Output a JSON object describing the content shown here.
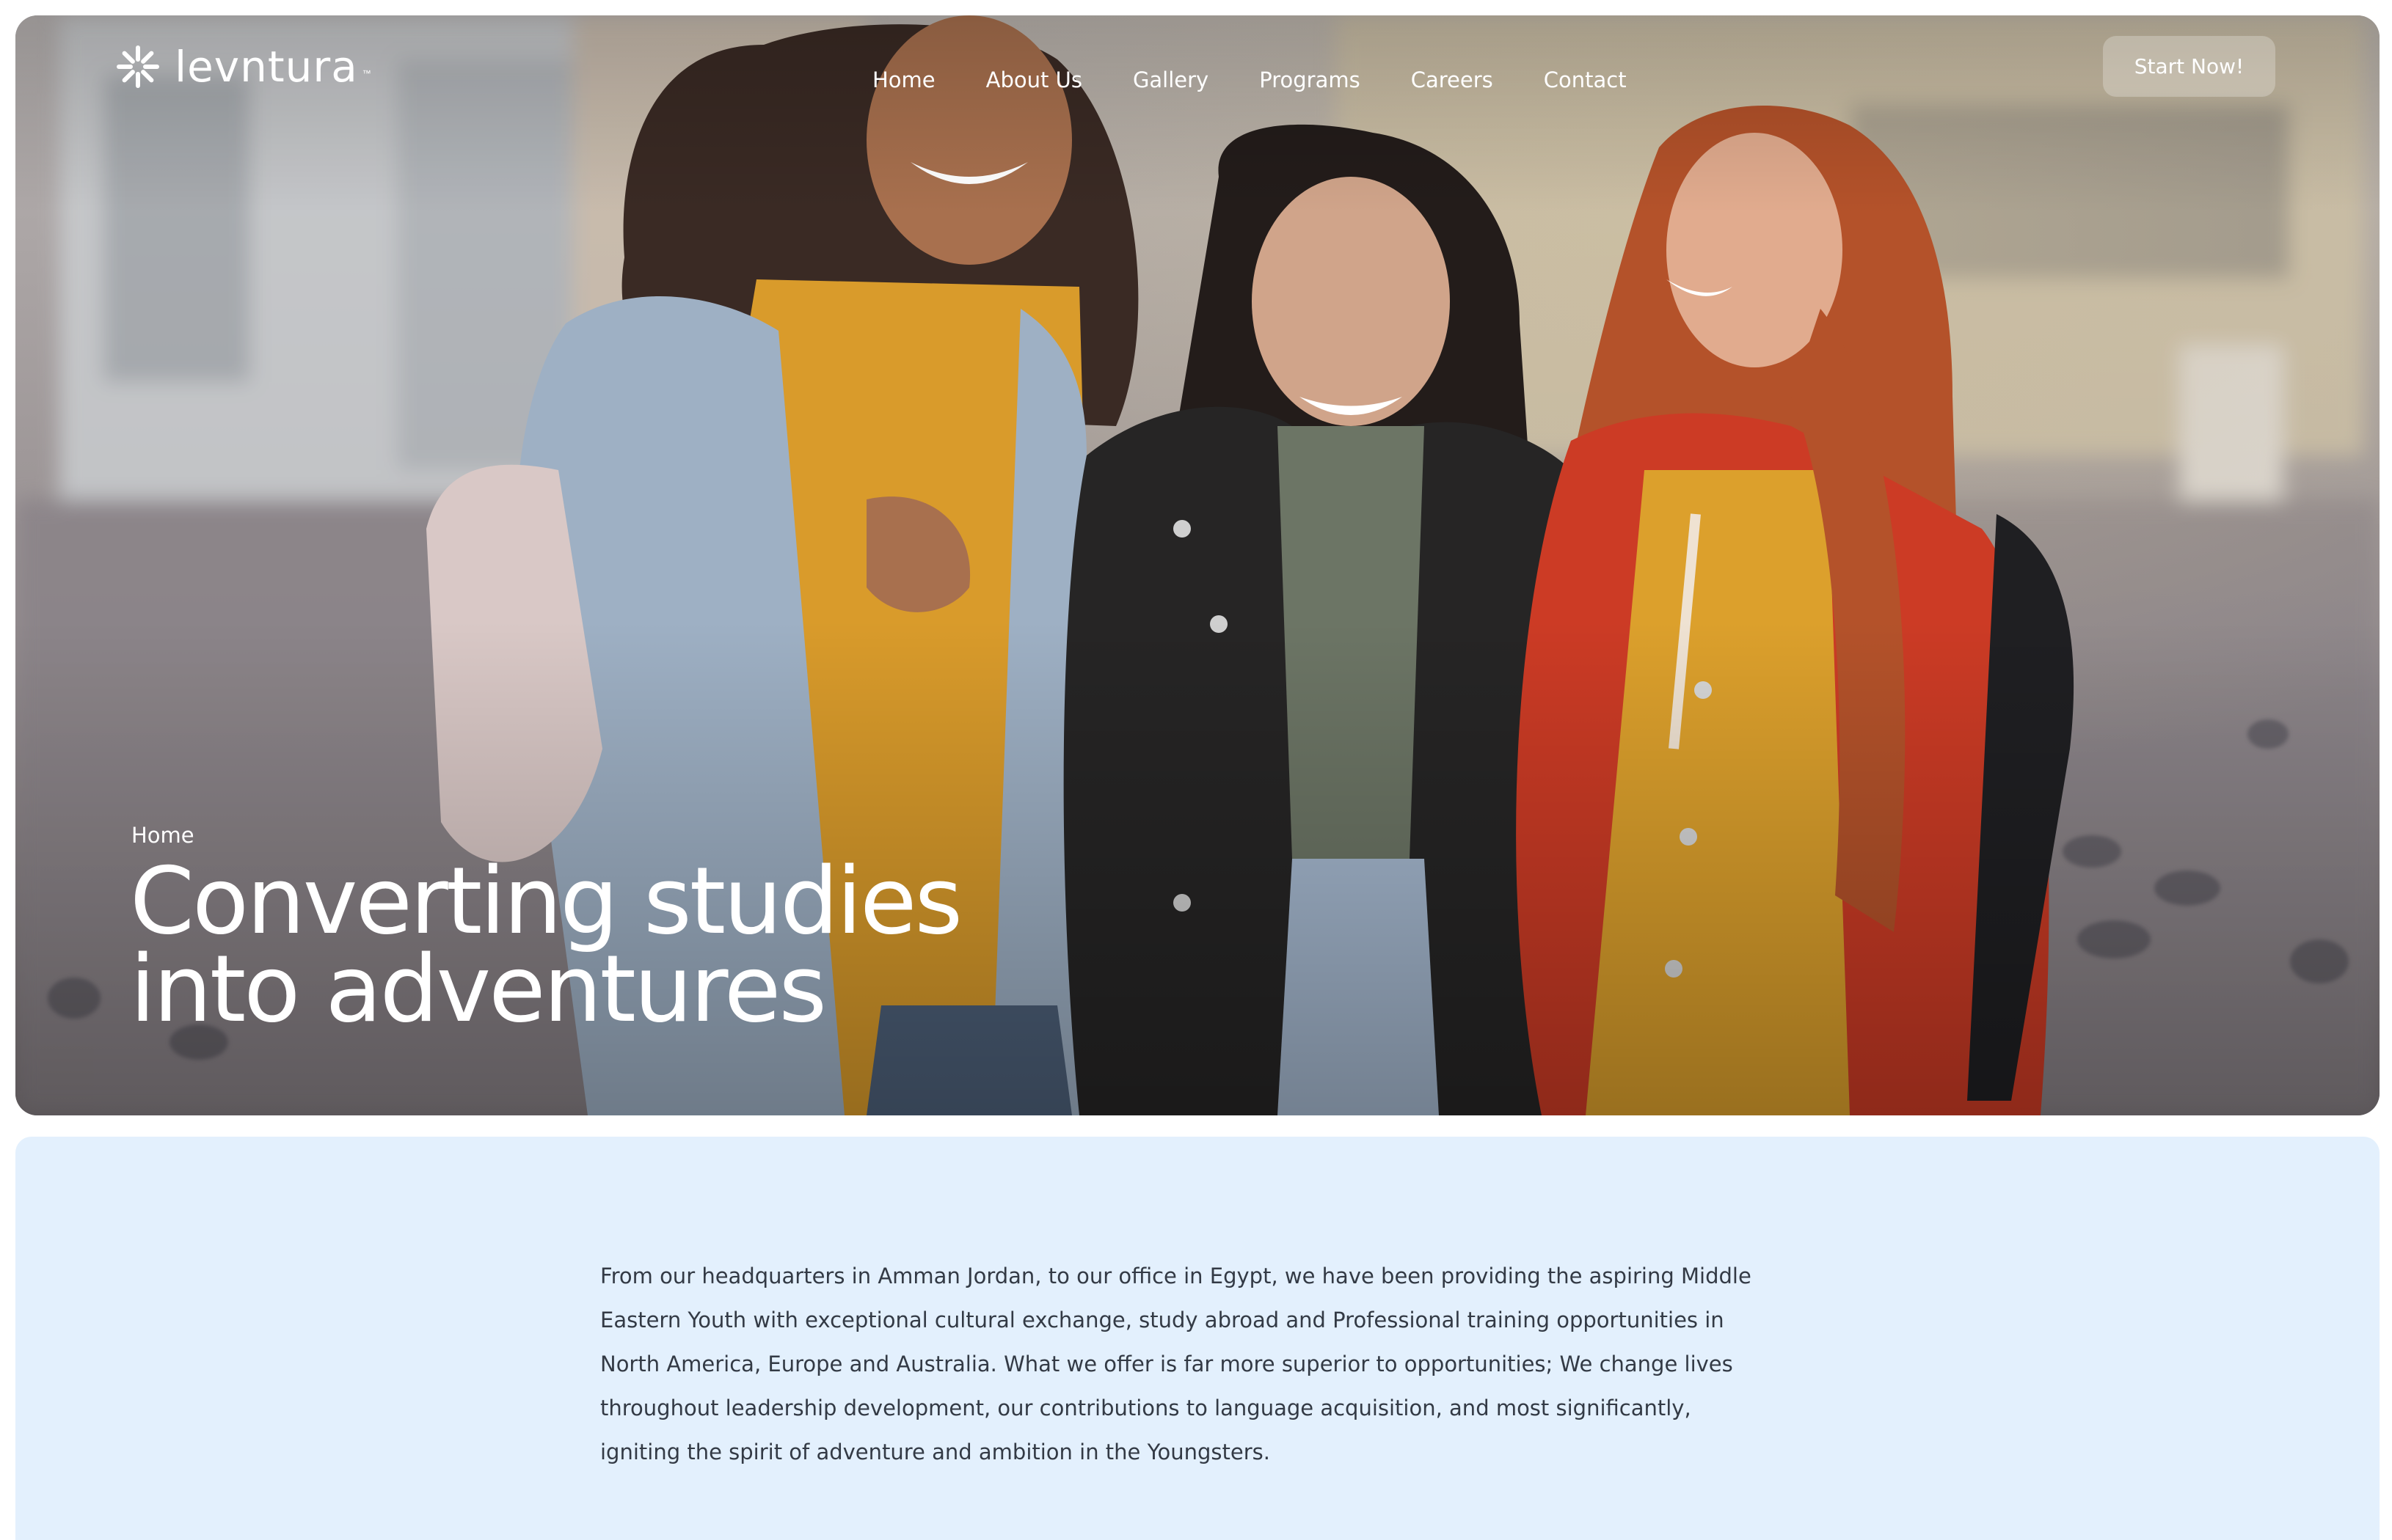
{
  "brand": {
    "name": "levntura",
    "trademark": "™"
  },
  "nav": {
    "items": [
      "Home",
      "About Us",
      "Gallery",
      "Programs",
      "Careers",
      "Contact"
    ],
    "cta_label": "Start Now!"
  },
  "hero": {
    "breadcrumb": "Home",
    "headline_line1": "Converting studies",
    "headline_line2": "into adventures"
  },
  "about": {
    "paragraph": "From our headquarters in Amman Jordan, to our office in Egypt, we have been providing the aspiring Middle Eastern Youth with exceptional cultural exchange, study abroad and Professional training opportunities in North America, Europe and Australia. What we offer is far more superior to opportunities; We change lives throughout leadership development, our contributions to language acquisition, and most significantly, igniting the spirit of adventure and ambition in the Youngsters."
  },
  "colors": {
    "about_background": "#e3f0fd",
    "body_text": "#333a45",
    "hero_text": "#ffffff"
  }
}
